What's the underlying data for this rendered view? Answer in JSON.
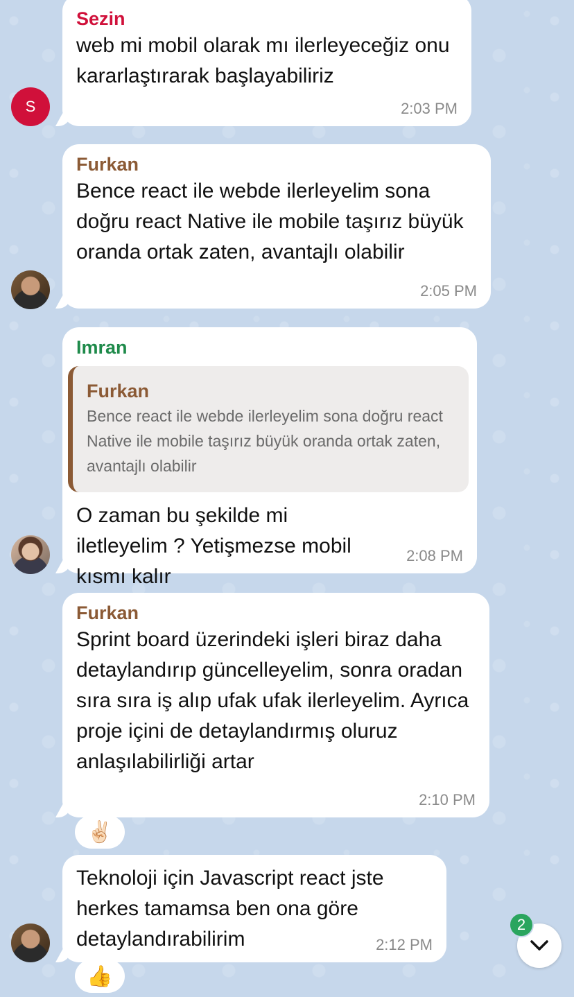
{
  "colors": {
    "sezin": "#d0103a",
    "furkan": "#8b5a35",
    "imran": "#1e8a4a",
    "bubble": "#ffffff",
    "badge": "#2aa55e"
  },
  "messages": [
    {
      "sender": "Sezin",
      "avatar_letter": "S",
      "text": "web mi mobil olarak mı ilerleyeceğiz onu kararlaştırarak başlayabiliriz",
      "time": "2:03 PM"
    },
    {
      "sender": "Furkan",
      "text": "Bence react ile webde ilerleyelim sona doğru react Native ile mobile taşırız büyük oranda ortak zaten, avantajlı olabilir",
      "time": "2:05 PM"
    },
    {
      "sender": "Imran",
      "reply": {
        "name": "Furkan",
        "text": "Bence react ile webde ilerleyelim sona doğru react Native ile mobile taşırız büyük oranda ortak zaten, avantajlı olabilir"
      },
      "text": "O zaman bu şekilde mi iletleyelim ? Yetişmezse mobil kısmı kalır",
      "time": "2:08 PM"
    },
    {
      "sender": "Furkan",
      "text": "Sprint board üzerindeki işleri biraz daha detaylandırıp güncelleyelim, sonra oradan sıra sıra iş alıp ufak ufak ilerleyelim. Ayrıca proje içini de detaylandırmış oluruz anlaşılabilirliği artar",
      "time": "2:10 PM",
      "reaction": "✌🏻"
    },
    {
      "text": "Teknoloji için Javascript react jste herkes tamamsa ben ona göre detaylandırabilirim",
      "time": "2:12 PM",
      "reaction": "👍"
    }
  ],
  "scroll_down": {
    "unread_count": "2",
    "icon": "chevron-down-icon"
  }
}
